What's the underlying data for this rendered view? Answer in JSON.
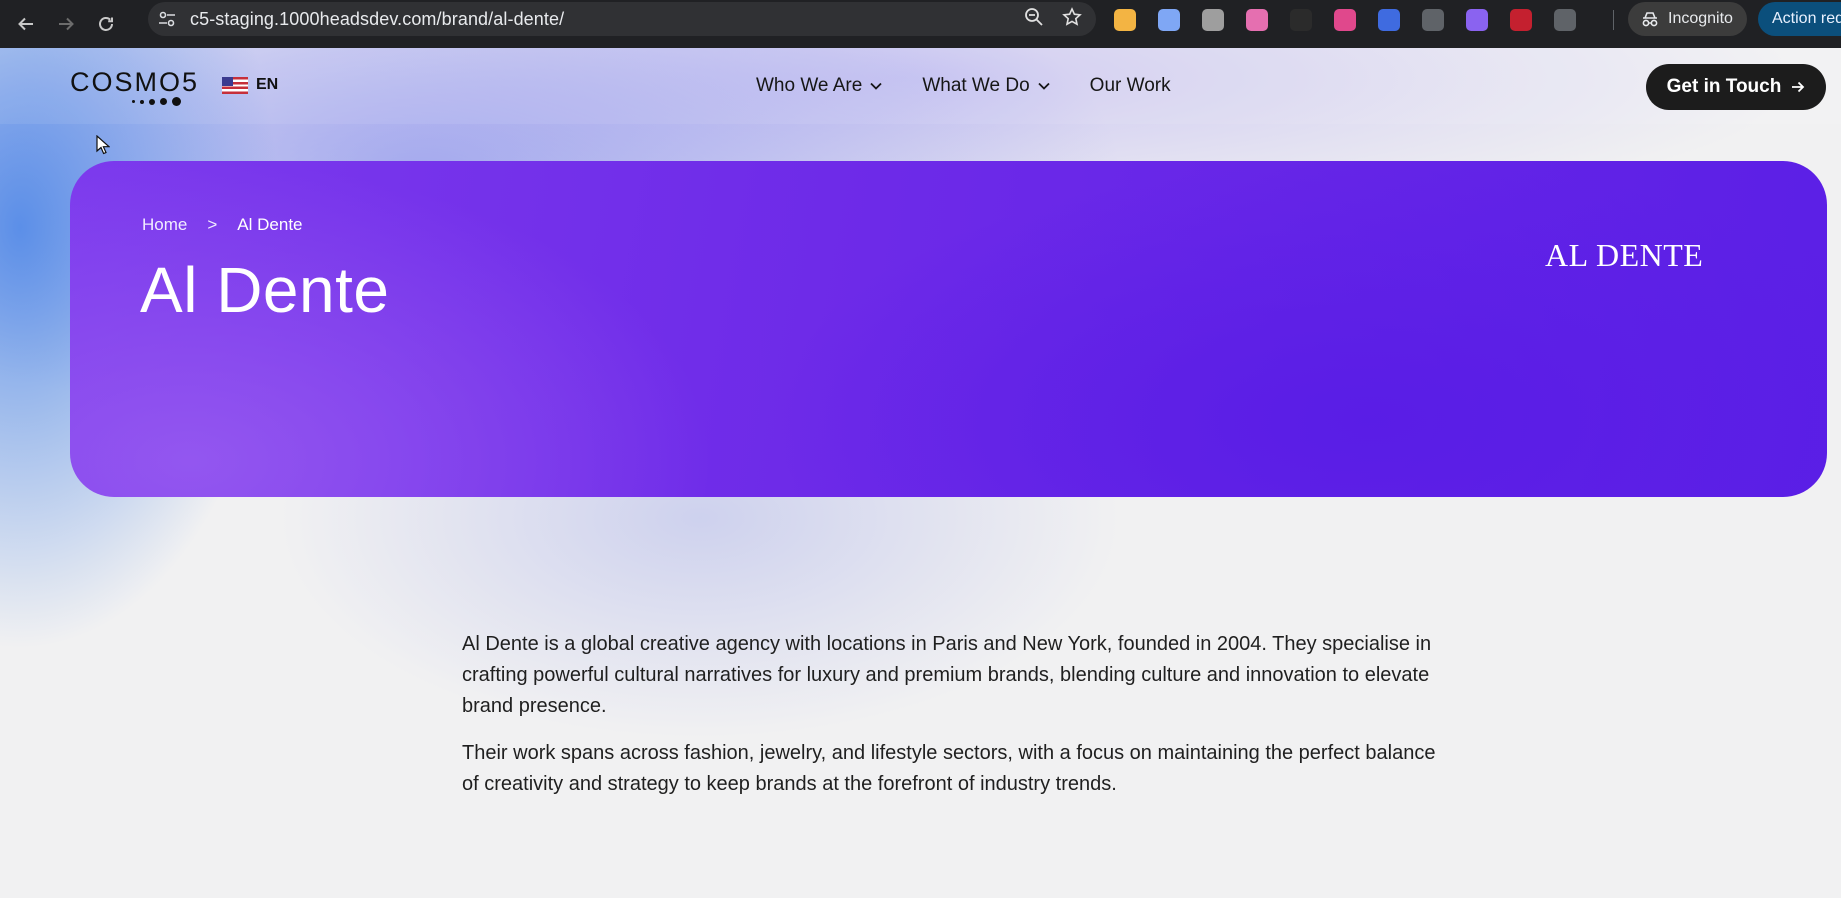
{
  "browser": {
    "url_host": "c5-staging.1000headsdev.com",
    "url_path": "/brand/al-dente/",
    "incognito_label": "Incognito",
    "action_label": "Action req",
    "extensions": [
      {
        "name": "ext-notes-icon",
        "color": "#f3b443"
      },
      {
        "name": "ext-docs-icon",
        "color": "#7fa7f5"
      },
      {
        "name": "ext-camera-icon",
        "color": "#9e9e9e"
      },
      {
        "name": "ext-gradient-icon",
        "color": "#e56fb0"
      },
      {
        "name": "ext-eyedropper-icon",
        "color": "#2b2b2b"
      },
      {
        "name": "ext-video-icon",
        "color": "#e0488c"
      },
      {
        "name": "ext-stripes-icon",
        "color": "#3f6be0"
      },
      {
        "name": "ext-compass-icon",
        "color": "#5f6368"
      },
      {
        "name": "ext-lens-icon",
        "color": "#8a63f0"
      },
      {
        "name": "ext-ublock-icon",
        "color": "#c4202f"
      },
      {
        "name": "ext-puzzle-icon",
        "color": "#5f6368"
      }
    ]
  },
  "header": {
    "logo_text": "COSMO5",
    "language": "EN",
    "nav": [
      {
        "label": "Who We Are",
        "has_dropdown": true
      },
      {
        "label": "What We Do",
        "has_dropdown": true
      },
      {
        "label": "Our Work",
        "has_dropdown": false
      }
    ],
    "cta_label": "Get in Touch"
  },
  "hero": {
    "breadcrumb_home": "Home",
    "breadcrumb_separator": ">",
    "breadcrumb_current": "Al Dente",
    "title": "Al Dente",
    "brand_logo_text": "AL DENTE"
  },
  "content": {
    "paragraphs": [
      "Al Dente is a global creative agency with locations in Paris and New York, founded in 2004. They specialise in crafting powerful cultural narratives for luxury and premium brands, blending culture and innovation to elevate brand presence.",
      "Their work spans across fashion, jewelry, and lifestyle sectors, with a focus on maintaining the perfect balance of creativity and strategy to keep brands at the forefront of industry trends."
    ]
  },
  "colors": {
    "hero_purple": "#6d2ae8",
    "cta_background": "#1c1c1c",
    "chrome_background": "#202124"
  }
}
